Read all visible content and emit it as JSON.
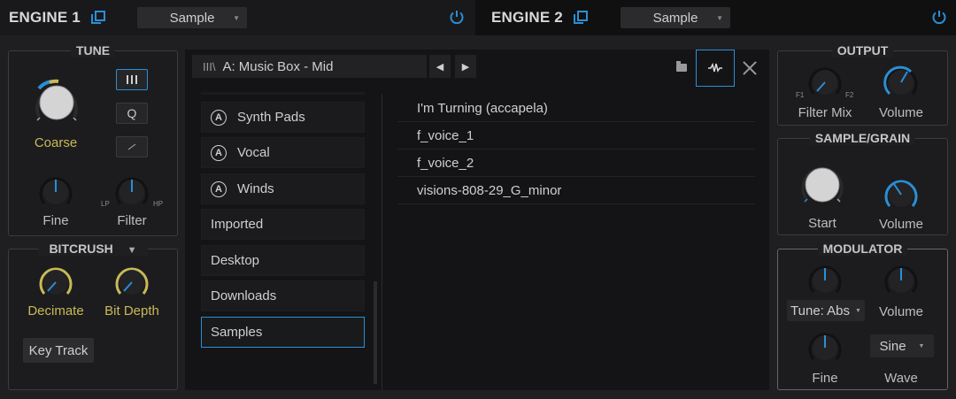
{
  "engine1": {
    "title": "ENGINE 1",
    "source": "Sample"
  },
  "engine2": {
    "title": "ENGINE 2",
    "source": "Sample"
  },
  "tune": {
    "title": "TUNE",
    "coarse_label": "Coarse",
    "fine_label": "Fine",
    "filter_label": "Filter",
    "filter_lp": "LP",
    "filter_hp": "HP",
    "mode_q": "Q"
  },
  "bitcrush": {
    "title": "BITCRUSH",
    "decimate_label": "Decimate",
    "bitdepth_label": "Bit Depth",
    "keytrack_label": "Key Track"
  },
  "browser": {
    "path": "A:  Music Box - Mid",
    "categories": [
      {
        "label": "Synth Pads",
        "badge": "A"
      },
      {
        "label": "Vocal",
        "badge": "A"
      },
      {
        "label": "Winds",
        "badge": "A"
      }
    ],
    "locations": [
      "Imported",
      "Desktop",
      "Downloads",
      "Samples"
    ],
    "selected_location": "Samples",
    "files": [
      "I'm Turning (accapela)",
      "f_voice_1",
      "f_voice_2",
      "visions-808-29_G_minor"
    ]
  },
  "output": {
    "title": "OUTPUT",
    "filter_mix_label": "Filter Mix",
    "f1": "F1",
    "f2": "F2",
    "volume_label": "Volume"
  },
  "sample_grain": {
    "title": "SAMPLE/GRAIN",
    "start_label": "Start",
    "volume_label": "Volume"
  },
  "modulator": {
    "title": "MODULATOR",
    "tune_mode": "Tune: Abs",
    "volume_label": "Volume",
    "fine_label": "Fine",
    "wave_value": "Sine",
    "wave_label": "Wave"
  },
  "colors": {
    "accent": "#2a8fd6",
    "yellow": "#c9b957"
  }
}
